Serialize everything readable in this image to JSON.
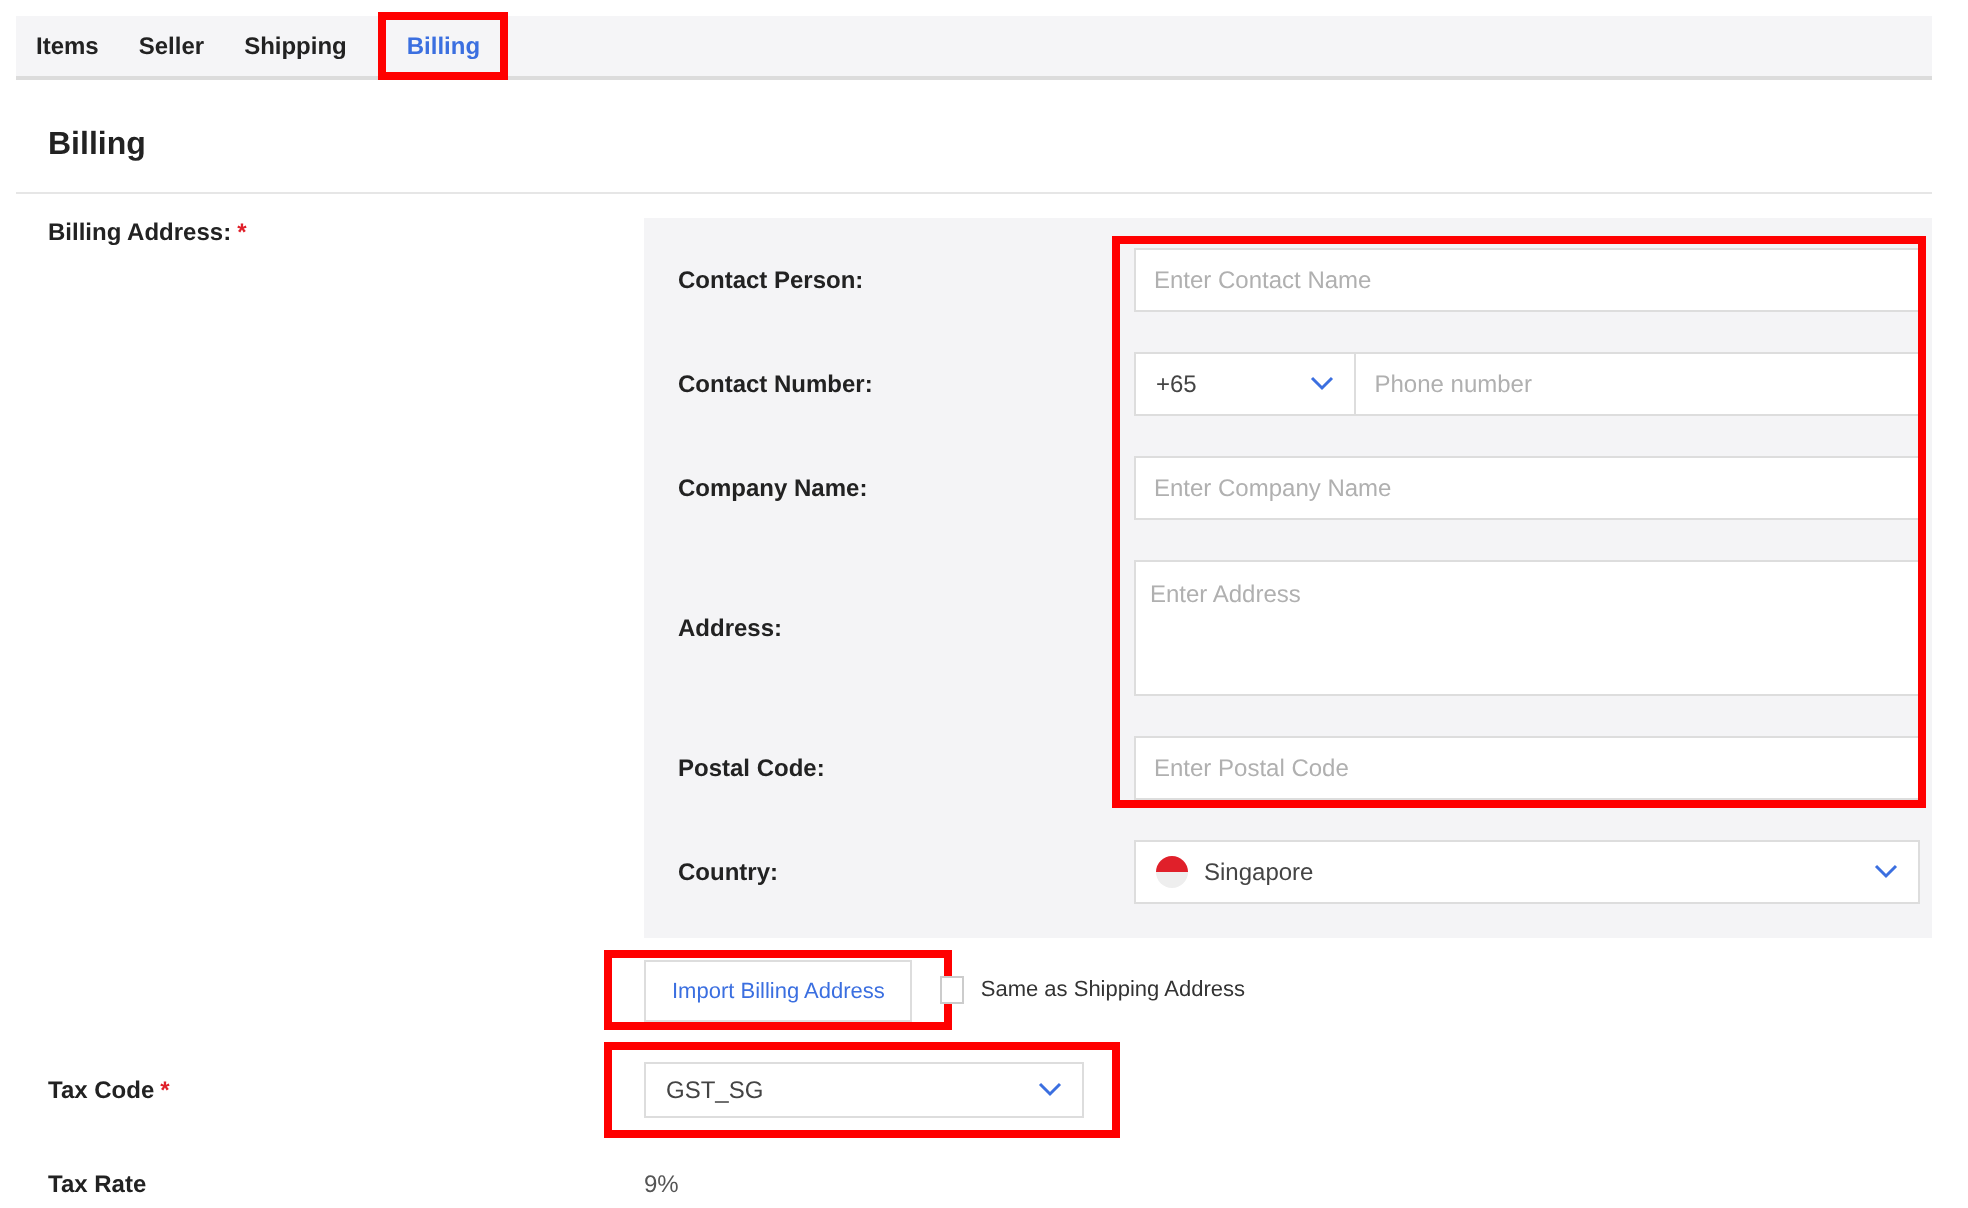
{
  "tabs": [
    {
      "label": "Items",
      "selected": false,
      "highlighted": false
    },
    {
      "label": "Seller",
      "selected": false,
      "highlighted": false
    },
    {
      "label": "Shipping",
      "selected": false,
      "highlighted": false
    },
    {
      "label": "Billing",
      "selected": true,
      "highlighted": true
    }
  ],
  "section_title": "Billing",
  "billing_address": {
    "label": "Billing Address:",
    "required_mark": "*",
    "fields": [
      {
        "kind": "text",
        "label": "Contact Person:",
        "placeholder": "Enter Contact Name",
        "highlighted": true
      },
      {
        "kind": "phone",
        "label": "Contact Number:",
        "code": "+65",
        "placeholder": "Phone number",
        "highlighted": true
      },
      {
        "kind": "text",
        "label": "Company Name:",
        "placeholder": "Enter Company Name",
        "highlighted": true
      },
      {
        "kind": "textarea",
        "label": "Address:",
        "placeholder": "Enter Address",
        "highlighted": true
      },
      {
        "kind": "text",
        "label": "Postal Code:",
        "placeholder": "Enter Postal Code",
        "highlighted": true
      },
      {
        "kind": "country",
        "label": "Country:",
        "value": "Singapore",
        "highlighted": false
      }
    ],
    "import_button": {
      "label": "Import Billing Address",
      "highlighted": true
    },
    "same_as_shipping": {
      "label": "Same as Shipping Address",
      "checked": false
    }
  },
  "tax_code": {
    "label": "Tax Code",
    "required_mark": "*",
    "value": "GST_SG",
    "highlighted": true
  },
  "tax_rate": {
    "label": "Tax Rate",
    "value": "9%"
  }
}
